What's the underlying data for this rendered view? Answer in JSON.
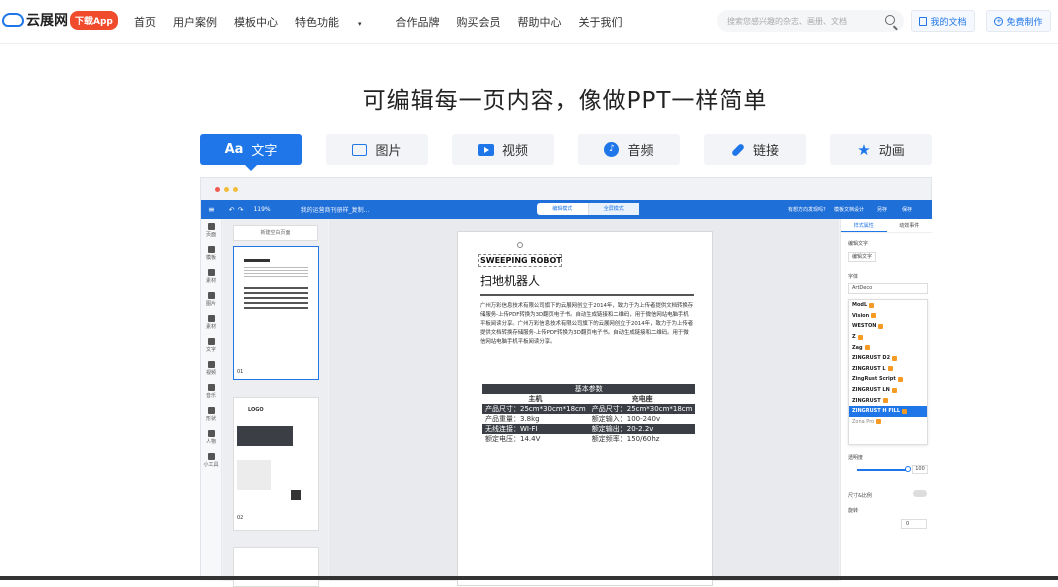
{
  "header": {
    "logo_text": "云展网",
    "download_badge": "下载App",
    "nav": [
      "首页",
      "用户案例",
      "模板中心",
      "特色功能",
      "合作品牌",
      "购买会员",
      "帮助中心",
      "关于我们"
    ],
    "nav_caret": "▾",
    "search_placeholder": "搜索您感兴趣的杂志、画册、文档",
    "my_docs": "我的文档",
    "free_make": "免费制作"
  },
  "headline": "可编辑每一页内容，像做PPT一样简单",
  "tabs": [
    {
      "label": "文字",
      "icon": "Aa"
    },
    {
      "label": "图片"
    },
    {
      "label": "视频"
    },
    {
      "label": "音频",
      "icon": "♪"
    },
    {
      "label": "链接"
    },
    {
      "label": "动画",
      "icon": "★"
    }
  ],
  "editor": {
    "zoom": "119%",
    "doc_title": "我的运营商刊册样_复制...",
    "mode_left": "编辑模式",
    "mode_right": "全屏模式",
    "top_right": [
      "有想方向发现吗?",
      "模板文档设计",
      "另存",
      "保存"
    ],
    "rail": [
      "页面",
      "模板",
      "素材",
      "图片",
      "素材",
      "文字",
      "视频",
      "音乐",
      "形状",
      "人物",
      "小工具"
    ],
    "add_page": "新建空白页面",
    "thumb_labels": [
      "01",
      "02"
    ],
    "thumb2_logo": "LOGO",
    "page": {
      "title_en": "SWEEPING ROBOT",
      "title_cn": "扫地机器人",
      "body": "广州万彩信息技术有限公司旗下的云展网创立于2014年，致力于为上传者提供文档转换存储服务-上传PDF转换为3D翻页电子书。自动生成链接和二维码，用于微信网站电脑手机平板阅读分享。广州万彩信息技术有限公司旗下的云展网创立于2014年，致力于为上传者提供文档转换存储服务-上传PDF转换为3D翻页电子书。自动生成链接和二维码。用于微信网站电脑手机平板阅读分享。",
      "params_title": "基本参数",
      "col_left": "主机",
      "col_right": "充电座",
      "rows": [
        [
          "产品尺寸：25cm*30cm*18cm",
          "产品尺寸：25cm*30cm*18cm"
        ],
        [
          "产品重量：3.8kg",
          "额定输入：100-240v"
        ],
        [
          "无线连接：WI-FI",
          "额定输出：20-2.2v"
        ],
        [
          "额定电压：14.4V",
          "额定频率：150/60hz"
        ]
      ]
    },
    "rpanel": {
      "tab_style": "样式属性",
      "tab_anim": "动效事件",
      "edit_text": "编辑文字",
      "edit_text_btn": "编辑文字",
      "font_label": "字体",
      "font_value": "ArtDeco",
      "fonts": [
        "ModL",
        "Vision",
        "WESTON",
        "Z",
        "Zag",
        "ZINGRUST D2",
        "ZINGRUST L",
        "ZingRust Script",
        "ZINGRUST LN",
        "ZINGRUST",
        "ZINGRUST H FILL",
        "Zona Pro"
      ],
      "opacity_label": "透明度",
      "opacity_value": "100",
      "size_lock": "尺寸&比例",
      "rotate_label": "旋转",
      "rotate_value": "0"
    }
  },
  "colors": {
    "brand": "#1e76e8",
    "badge": "#f04b2c",
    "toolbar": "#1f6fd9"
  }
}
